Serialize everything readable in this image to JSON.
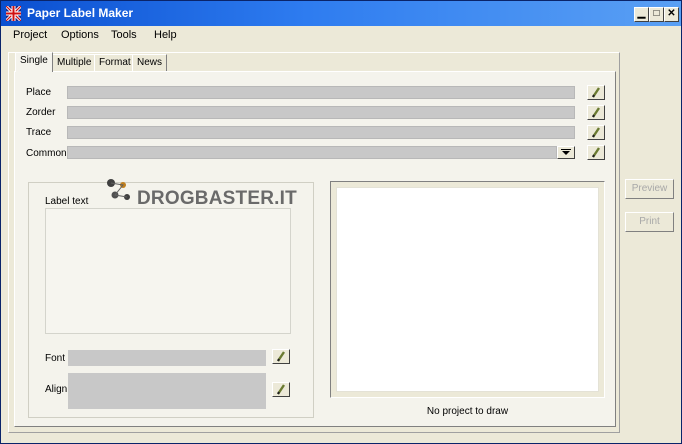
{
  "window": {
    "title": "Paper Label Maker"
  },
  "menu": [
    "Project",
    "Options",
    "Tools",
    "Help"
  ],
  "tabs": [
    {
      "label": "Single",
      "active": true
    },
    {
      "label": "Multiple",
      "active": false
    },
    {
      "label": "Format",
      "active": false
    },
    {
      "label": "News",
      "active": false
    }
  ],
  "fields": {
    "place": {
      "label": "Place",
      "value": ""
    },
    "zorder": {
      "label": "Zorder",
      "value": ""
    },
    "trace": {
      "label": "Trace",
      "value": ""
    },
    "common": {
      "label": "Common",
      "value": ""
    }
  },
  "label_group": {
    "title": "Label text",
    "text": "",
    "font_label": "Font",
    "align_label": "Align"
  },
  "watermark": "DROGBASTER.IT",
  "preview": {
    "status": "No project to draw"
  },
  "buttons": {
    "preview": "Preview",
    "print": "Print"
  },
  "icons": [
    "app-flag-icon",
    "pencil-icon",
    "dropdown-arrow-icon",
    "minimize-icon",
    "maximize-icon",
    "close-icon"
  ],
  "colors": {
    "title_bar": "#0a4fd0",
    "panel": "#f4f3ec",
    "field": "#c8c8c8"
  }
}
